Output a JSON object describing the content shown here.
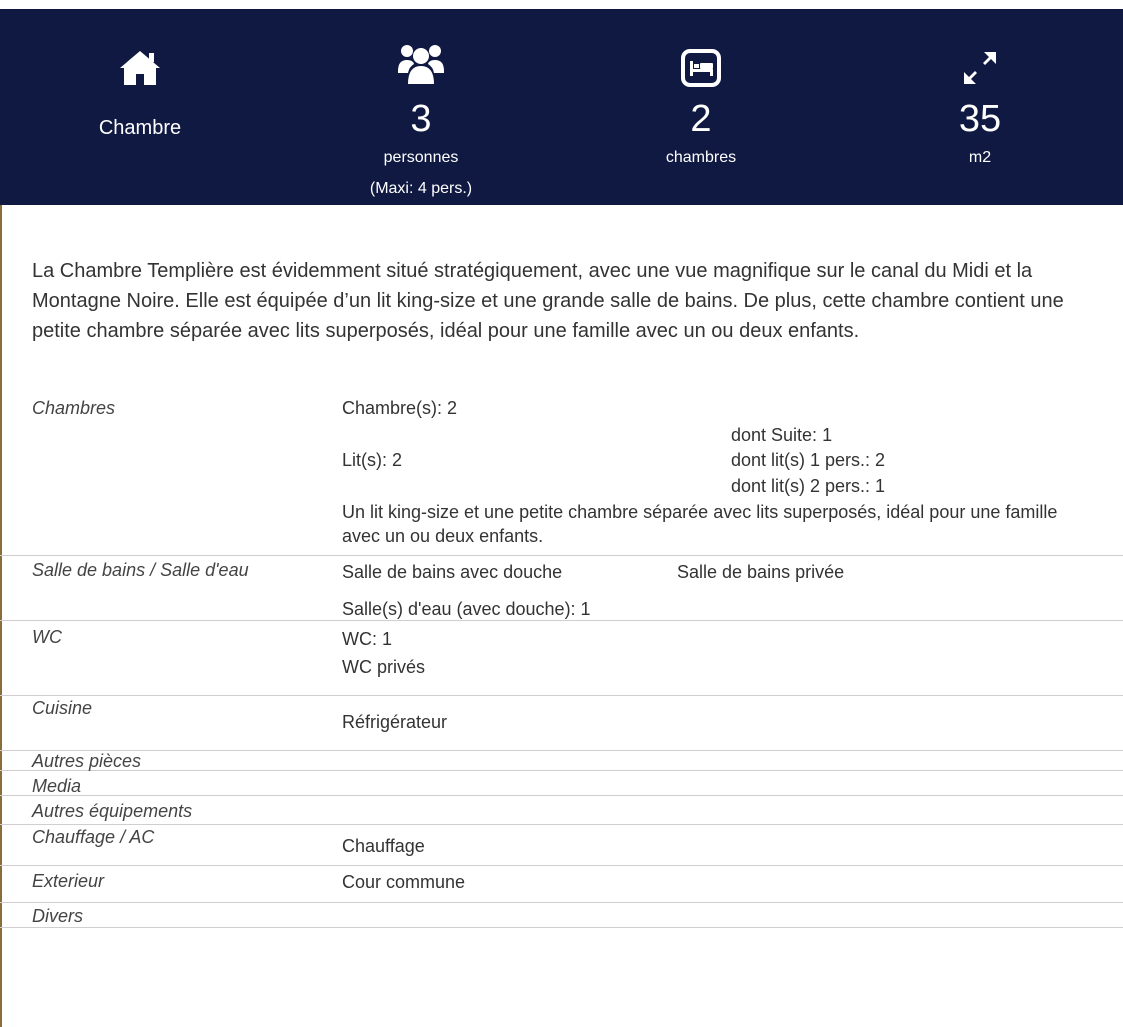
{
  "summary": {
    "type_label": "Chambre",
    "persons": {
      "value": "3",
      "label": "personnes",
      "max": "(Maxi: 4 pers.)"
    },
    "bedrooms": {
      "value": "2",
      "label": "chambres"
    },
    "surface": {
      "value": "35",
      "label": "m2"
    }
  },
  "description": "La Chambre Templière est évidemment situé stratégiquement, avec une vue magnifique sur le canal du Midi et la Montagne Noire. Elle est équipée d’un lit king-size et une grande salle de bains. De plus, cette chambre contient une petite chambre séparée avec lits superposés, idéal pour une famille avec un ou deux enfants.",
  "details": {
    "chambres": {
      "label": "Chambres",
      "count": "Chambre(s): 2",
      "suite": "dont Suite: 1",
      "beds": "Lit(s):  2",
      "single_beds": "dont lit(s) 1 pers.: 2",
      "double_beds": "dont lit(s) 2 pers.: 1",
      "note": "Un lit king-size et une petite chambre séparée avec lits superposés, idéal pour une famille avec un ou deux enfants."
    },
    "salle_de_bains": {
      "label": "Salle de bains / Salle d'eau",
      "item1": "Salle de bains avec douche",
      "item2": "Salle de bains privée",
      "item3": "Salle(s) d'eau (avec douche):  1"
    },
    "wc": {
      "label": "WC",
      "item1": "WC:  1",
      "item2": "WC privés"
    },
    "cuisine": {
      "label": "Cuisine",
      "item1": "Réfrigérateur"
    },
    "autres_pieces": {
      "label": "Autres pièces"
    },
    "media": {
      "label": "Media"
    },
    "autres_equipements": {
      "label": "Autres équipements"
    },
    "chauffage": {
      "label": "Chauffage / AC",
      "item1": "Chauffage"
    },
    "exterieur": {
      "label": "Exterieur",
      "item1": "Cour commune"
    },
    "divers": {
      "label": "Divers"
    }
  },
  "icons": {
    "type": "home-icon",
    "persons": "users-icon",
    "bedrooms": "bed-icon",
    "surface": "expand-arrows-icon"
  },
  "colors": {
    "header_bg": "#0f1942",
    "header_text": "#ffffff",
    "divider": "#cfcfcf"
  }
}
